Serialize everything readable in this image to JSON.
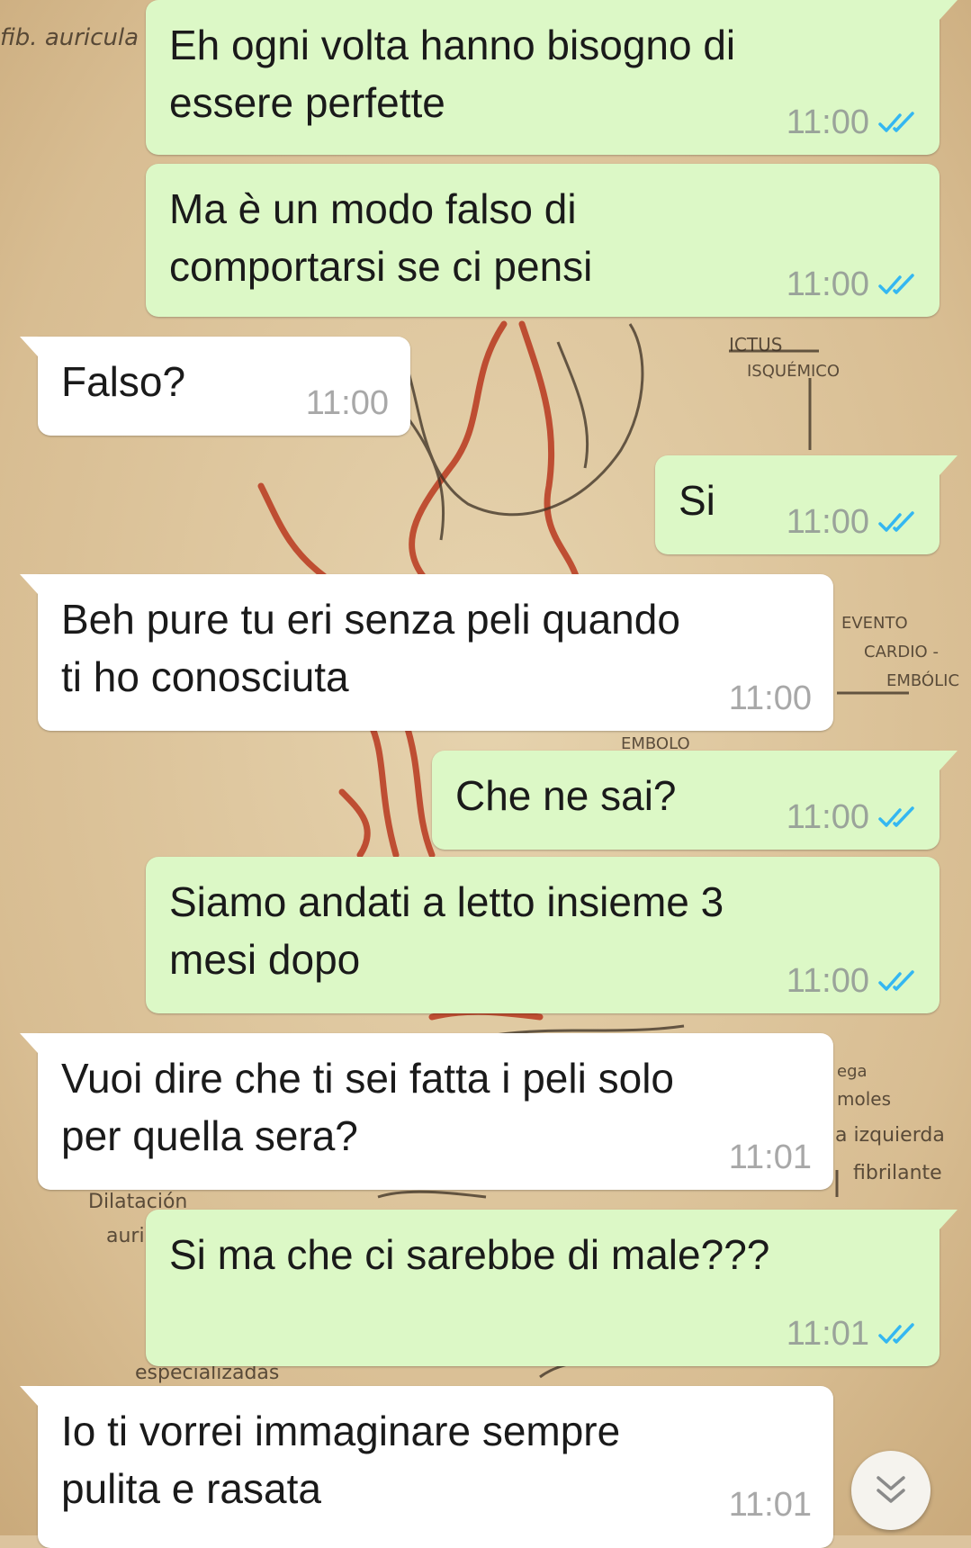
{
  "colors": {
    "outgoing_bubble": "#dcf8c6",
    "incoming_bubble": "#ffffff",
    "read_ticks": "#34b7f1",
    "timestamp": "#9aa39a"
  },
  "messages": [
    {
      "dir": "out",
      "text": "Eh ogni volta hanno bisogno di\nessere perfette",
      "time": "11:00",
      "status": "read"
    },
    {
      "dir": "out",
      "text": "Ma è un modo falso di\ncomportarsi se ci pensi",
      "time": "11:00",
      "status": "read"
    },
    {
      "dir": "in",
      "text": "Falso?",
      "time": "11:00"
    },
    {
      "dir": "out",
      "text": "Si",
      "time": "11:00",
      "status": "read"
    },
    {
      "dir": "in",
      "text": "Beh pure tu eri senza peli quando\nti ho conosciuta",
      "time": "11:00"
    },
    {
      "dir": "out",
      "text": "Che ne sai?",
      "time": "11:00",
      "status": "read"
    },
    {
      "dir": "out",
      "text": "Siamo andati a letto insieme 3\nmesi dopo",
      "time": "11:00",
      "status": "read"
    },
    {
      "dir": "in",
      "text": "Vuoi dire che ti sei fatta i peli solo\nper quella sera?",
      "time": "11:01"
    },
    {
      "dir": "out",
      "text": "Si ma che ci sarebbe di male???",
      "time": "11:01",
      "status": "read"
    },
    {
      "dir": "in",
      "text": "Io ti vorrei immaginare sempre\npulita e rasata",
      "time": "11:01"
    }
  ],
  "wallpaper_notes": {
    "n1": "fib. auricula",
    "n2": "ICTUS",
    "n3": "ISQUÉMICO",
    "n4": "EVENTO",
    "n5": "CARDIO -",
    "n6": "EMBÓLIC",
    "n7": "EMBOLO",
    "n8": "ega",
    "n9": "moles",
    "n10": "a izquierda",
    "n11": "fibrilante",
    "n12": "Dilatación",
    "n13": "auri",
    "n14": "especializadas"
  },
  "scroll_button": {
    "icon": "double-chevron-down-icon"
  }
}
